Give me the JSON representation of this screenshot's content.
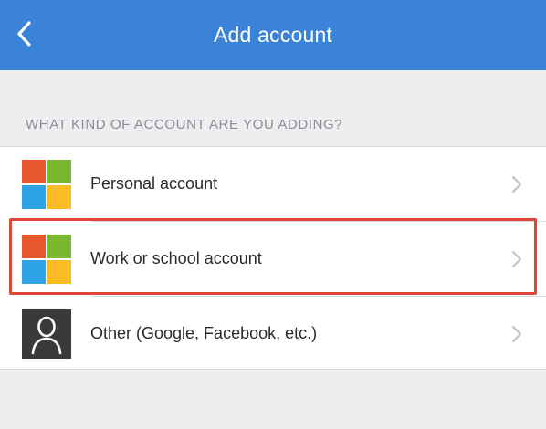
{
  "header": {
    "title": "Add account",
    "back_icon": "chevron-left-icon",
    "background": "#3b82d9"
  },
  "section": {
    "label": "WHAT KIND OF ACCOUNT ARE YOU ADDING?"
  },
  "options": [
    {
      "label": "Personal account",
      "icon": "microsoft-logo-icon"
    },
    {
      "label": "Work or school account",
      "icon": "microsoft-logo-icon",
      "highlighted": true
    },
    {
      "label": "Other (Google, Facebook, etc.)",
      "icon": "person-icon"
    }
  ],
  "colors": {
    "ms_red": "#e8572c",
    "ms_green": "#7cb82f",
    "ms_blue": "#2ea3e6",
    "ms_yellow": "#fbbc23",
    "highlight": "#e0453a"
  }
}
